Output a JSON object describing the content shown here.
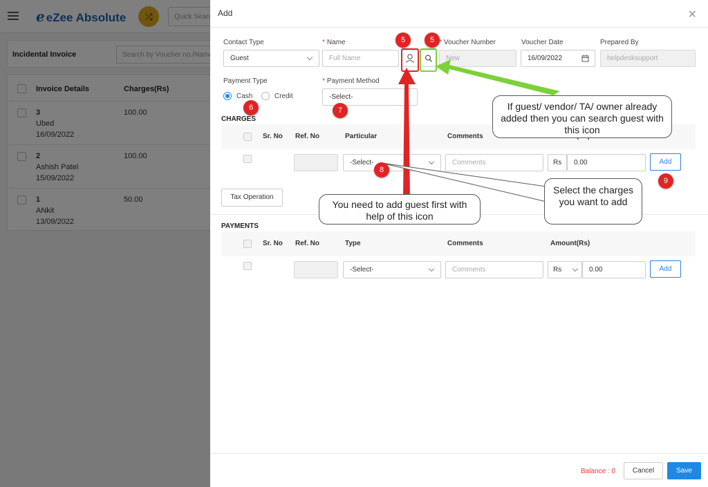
{
  "app": {
    "logo": "eZee Absolute",
    "quick_search_placeholder": "Quick Search",
    "page_title": "Incidental Invoice",
    "list_search_placeholder": "Search by Voucher no./Name",
    "columns": [
      "Invoice Details",
      "Charges(Rs)"
    ],
    "rows": [
      {
        "no": "3",
        "name": "Ubed",
        "date": "16/09/2022",
        "amount": "100.00"
      },
      {
        "no": "2",
        "name": "Ashish Patel",
        "date": "15/09/2022",
        "amount": "100.00"
      },
      {
        "no": "1",
        "name": "ANkit",
        "date": "13/09/2022",
        "amount": "50.00"
      }
    ]
  },
  "modal": {
    "title": "Add",
    "contact_type": {
      "label": "Contact Type",
      "value": "Guest"
    },
    "name": {
      "label": "Name",
      "placeholder": "Full Name"
    },
    "voucher_number": {
      "label": "Voucher Number",
      "value": "New"
    },
    "voucher_date": {
      "label": "Voucher Date",
      "value": "16/09/2022"
    },
    "prepared_by": {
      "label": "Prepared By",
      "value": "helpdesksupport"
    },
    "payment_type": {
      "label": "Payment Type",
      "options": [
        "Cash",
        "Credit"
      ],
      "selected": "Cash"
    },
    "payment_method": {
      "label": "Payment Method",
      "value": "-Select-"
    },
    "charges": {
      "title": "CHARGES",
      "columns": [
        "Sr. No",
        "Ref. No",
        "Particular",
        "Comments",
        "Amount(Rs)"
      ],
      "particular": "-Select-",
      "comments_placeholder": "Comments",
      "currency": "Rs",
      "amount": "0.00",
      "add_label": "Add",
      "tax_button": "Tax Operation"
    },
    "payments": {
      "title": "PAYMENTS",
      "columns": [
        "Sr. No",
        "Ref. No",
        "Type",
        "Comments",
        "Amount(Rs)"
      ],
      "type": "-Select-",
      "comments_placeholder": "Comments",
      "currency": "Rs",
      "amount": "0.00",
      "add_label": "Add"
    },
    "balance": "Balance : 0",
    "cancel_label": "Cancel",
    "save_label": "Save"
  },
  "annotations": {
    "badges": [
      "5",
      "5",
      "6",
      "7",
      "8",
      "9"
    ],
    "search_tip": "If guest/ vendor/ TA/ owner already added then you can search guest with this icon",
    "charges_tip": "Select the charges you want to add",
    "add_guest_tip": "You need to add guest first with help of this icon",
    "colors": {
      "red": "#e02424",
      "green": "#7dd03a"
    }
  }
}
